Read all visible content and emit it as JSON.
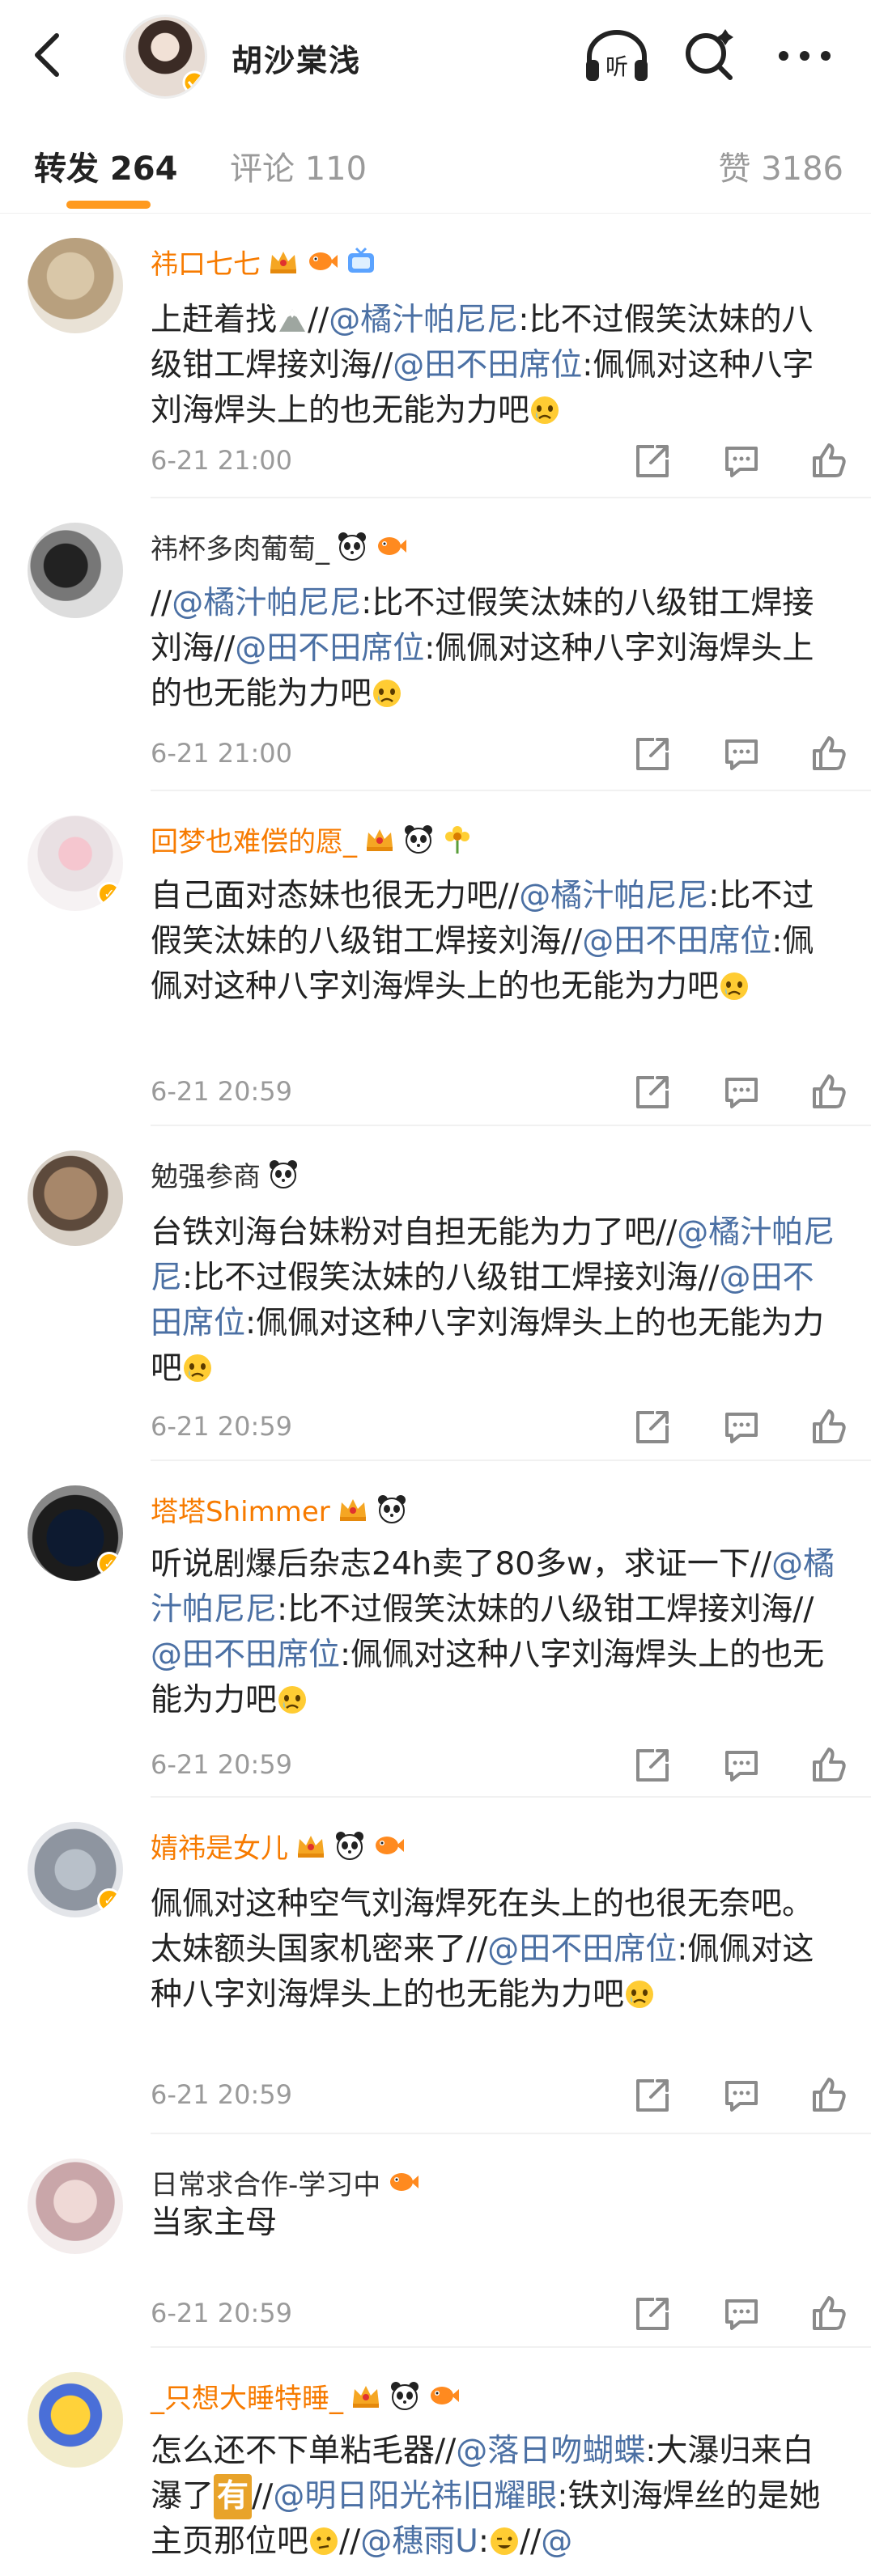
{
  "header": {
    "author_name": "胡沙棠浅",
    "listen_label": "听"
  },
  "tabs": {
    "repost": "转发 264",
    "comment": "评论 110",
    "like": "赞 3186"
  },
  "colors": {
    "accent": "#ff9a1f",
    "vip_name": "#f77b00",
    "mention": "#4b70a4",
    "time": "#9a9a9a"
  },
  "reposts": [
    {
      "name": "祎口七七",
      "vip": true,
      "badges": [
        "crown-badge",
        "fish-badge",
        "tv-badge"
      ],
      "parts": [
        {
          "t": "text",
          "v": "上赶着找"
        },
        {
          "t": "emoji",
          "v": "mountain-emoji"
        },
        {
          "t": "text",
          "v": "//"
        },
        {
          "t": "mention",
          "v": "@橘汁帕尼尼"
        },
        {
          "t": "text",
          "v": ":比不过假笑汰妹的八级钳工焊接刘海//"
        },
        {
          "t": "mention",
          "v": "@田不田席位"
        },
        {
          "t": "text",
          "v": ":佩佩对这种八字刘海焊头上的也无能为力吧"
        },
        {
          "t": "emoji",
          "v": "cry-emoji"
        }
      ],
      "time": "6-21 21:00"
    },
    {
      "name": "祎杯多肉葡萄_",
      "vip": false,
      "badges": [
        "panda-badge",
        "fish-badge"
      ],
      "parts": [
        {
          "t": "text",
          "v": "//"
        },
        {
          "t": "mention",
          "v": "@橘汁帕尼尼"
        },
        {
          "t": "text",
          "v": ":比不过假笑汰妹的八级钳工焊接刘海//"
        },
        {
          "t": "mention",
          "v": "@田不田席位"
        },
        {
          "t": "text",
          "v": ":佩佩对这种八字刘海焊头上的也无能为力吧"
        },
        {
          "t": "emoji",
          "v": "cry-emoji"
        }
      ],
      "time": "6-21 21:00"
    },
    {
      "name": "回梦也难偿的愿_",
      "vip": true,
      "badges": [
        "crown-badge",
        "panda-badge",
        "flower-badge"
      ],
      "parts": [
        {
          "t": "text",
          "v": "自己面对态妹也很无力吧//"
        },
        {
          "t": "mention",
          "v": "@橘汁帕尼尼"
        },
        {
          "t": "text",
          "v": ":比不过假笑汰妹的八级钳工焊接刘海//"
        },
        {
          "t": "mention",
          "v": "@田不田席位"
        },
        {
          "t": "text",
          "v": ":佩佩对这种八字刘海焊头上的也无能为力吧"
        },
        {
          "t": "emoji",
          "v": "cry-emoji"
        }
      ],
      "time": "6-21 20:59"
    },
    {
      "name": "勉强参商",
      "vip": false,
      "badges": [
        "panda-badge"
      ],
      "parts": [
        {
          "t": "text",
          "v": "台铁刘海台妹粉对自担无能为力了吧//"
        },
        {
          "t": "mention",
          "v": "@橘汁帕尼尼"
        },
        {
          "t": "text",
          "v": ":比不过假笑汰妹的八级钳工焊接刘海//"
        },
        {
          "t": "mention",
          "v": "@田不田席位"
        },
        {
          "t": "text",
          "v": ":佩佩对这种八字刘海焊头上的也无能为力吧"
        },
        {
          "t": "emoji",
          "v": "cry-emoji"
        }
      ],
      "time": "6-21 20:59"
    },
    {
      "name": "塔塔Shimmer",
      "vip": true,
      "badges": [
        "crown-badge",
        "panda-badge"
      ],
      "parts": [
        {
          "t": "text",
          "v": "听说剧爆后杂志24h卖了80多w，求证一下//"
        },
        {
          "t": "mention",
          "v": "@橘汁帕尼尼"
        },
        {
          "t": "text",
          "v": ":比不过假笑汰妹的八级钳工焊接刘海//"
        },
        {
          "t": "mention",
          "v": "@田不田席位"
        },
        {
          "t": "text",
          "v": ":佩佩对这种八字刘海焊头上的也无能为力吧"
        },
        {
          "t": "emoji",
          "v": "cry-emoji"
        }
      ],
      "time": "6-21 20:59"
    },
    {
      "name": "婧祎是女儿",
      "vip": true,
      "badges": [
        "crown-badge",
        "panda-badge",
        "fish-badge"
      ],
      "parts": [
        {
          "t": "text",
          "v": "佩佩对这种空气刘海焊死在头上的也很无奈吧。太妹额头国家机密来了//"
        },
        {
          "t": "mention",
          "v": "@田不田席位"
        },
        {
          "t": "text",
          "v": ":佩佩对这种八字刘海焊头上的也无能为力吧"
        },
        {
          "t": "emoji",
          "v": "cry-emoji"
        }
      ],
      "time": "6-21 20:59"
    },
    {
      "name": "日常求合作-学习中",
      "vip": false,
      "badges": [
        "fish-badge"
      ],
      "parts": [
        {
          "t": "text",
          "v": "当家主母"
        }
      ],
      "time": "6-21 20:59"
    },
    {
      "name": "_只想大睡特睡_",
      "vip": true,
      "badges": [
        "crown-badge",
        "panda-badge",
        "fish-badge"
      ],
      "parts": [
        {
          "t": "text",
          "v": "怎么还不下单粘毛器//"
        },
        {
          "t": "mention",
          "v": "@落日吻蝴蝶"
        },
        {
          "t": "text",
          "v": ":大瀑归来白瀑了"
        },
        {
          "t": "badge",
          "v": "有"
        },
        {
          "t": "text",
          "v": "//"
        },
        {
          "t": "mention",
          "v": "@明日阳光祎旧耀眼"
        },
        {
          "t": "text",
          "v": ":铁刘海焊丝的是她主页那位吧"
        },
        {
          "t": "emoji",
          "v": "think-emoji"
        },
        {
          "t": "text",
          "v": "//"
        },
        {
          "t": "mention",
          "v": "@穗雨U"
        },
        {
          "t": "text",
          "v": ":"
        },
        {
          "t": "emoji",
          "v": "wink-emoji"
        },
        {
          "t": "text",
          "v": "//"
        },
        {
          "t": "mention",
          "v": "@"
        }
      ],
      "time": ""
    }
  ]
}
